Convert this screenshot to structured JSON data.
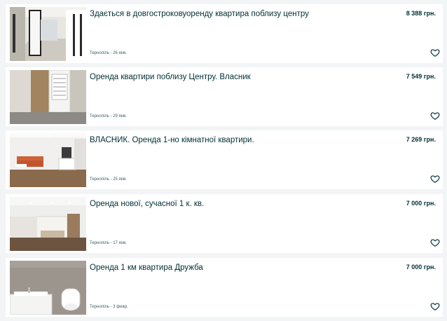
{
  "listings": [
    {
      "title": "Здається в довгостроковуоренду квартира поблизу центру",
      "price": "8 388 грн.",
      "meta": "Тернопіль - 26 янв.",
      "photo_icon": "apartment-hallway-photo"
    },
    {
      "title": "Оренда квартири поблизу Центру. Власник",
      "price": "7 549 грн.",
      "meta": "Тернопіль - 29 янв.",
      "photo_icon": "apartment-bathroom-photo"
    },
    {
      "title": "ВЛАСНИК. Оренда 1-но кімнатної квартири.",
      "price": "7 269 грн.",
      "meta": "Тернопіль - 25 янв.",
      "photo_icon": "apartment-living-room-photo"
    },
    {
      "title": "Оренда нової, сучасної 1 к. кв.",
      "price": "7 000 грн.",
      "meta": "Тернопіль - 17 янв.",
      "photo_icon": "apartment-kitchen-photo"
    },
    {
      "title": "Оренда 1 км квартира Дружба",
      "price": "7 000 грн.",
      "meta": "Тернопіль - 3 февр.",
      "photo_icon": "apartment-bathroom-photo"
    }
  ],
  "icons": {
    "favorite": "heart-outline-icon"
  },
  "colors": {
    "text": "#002f34",
    "meta": "#406367",
    "background": "#f2f4f5",
    "card": "#ffffff"
  }
}
